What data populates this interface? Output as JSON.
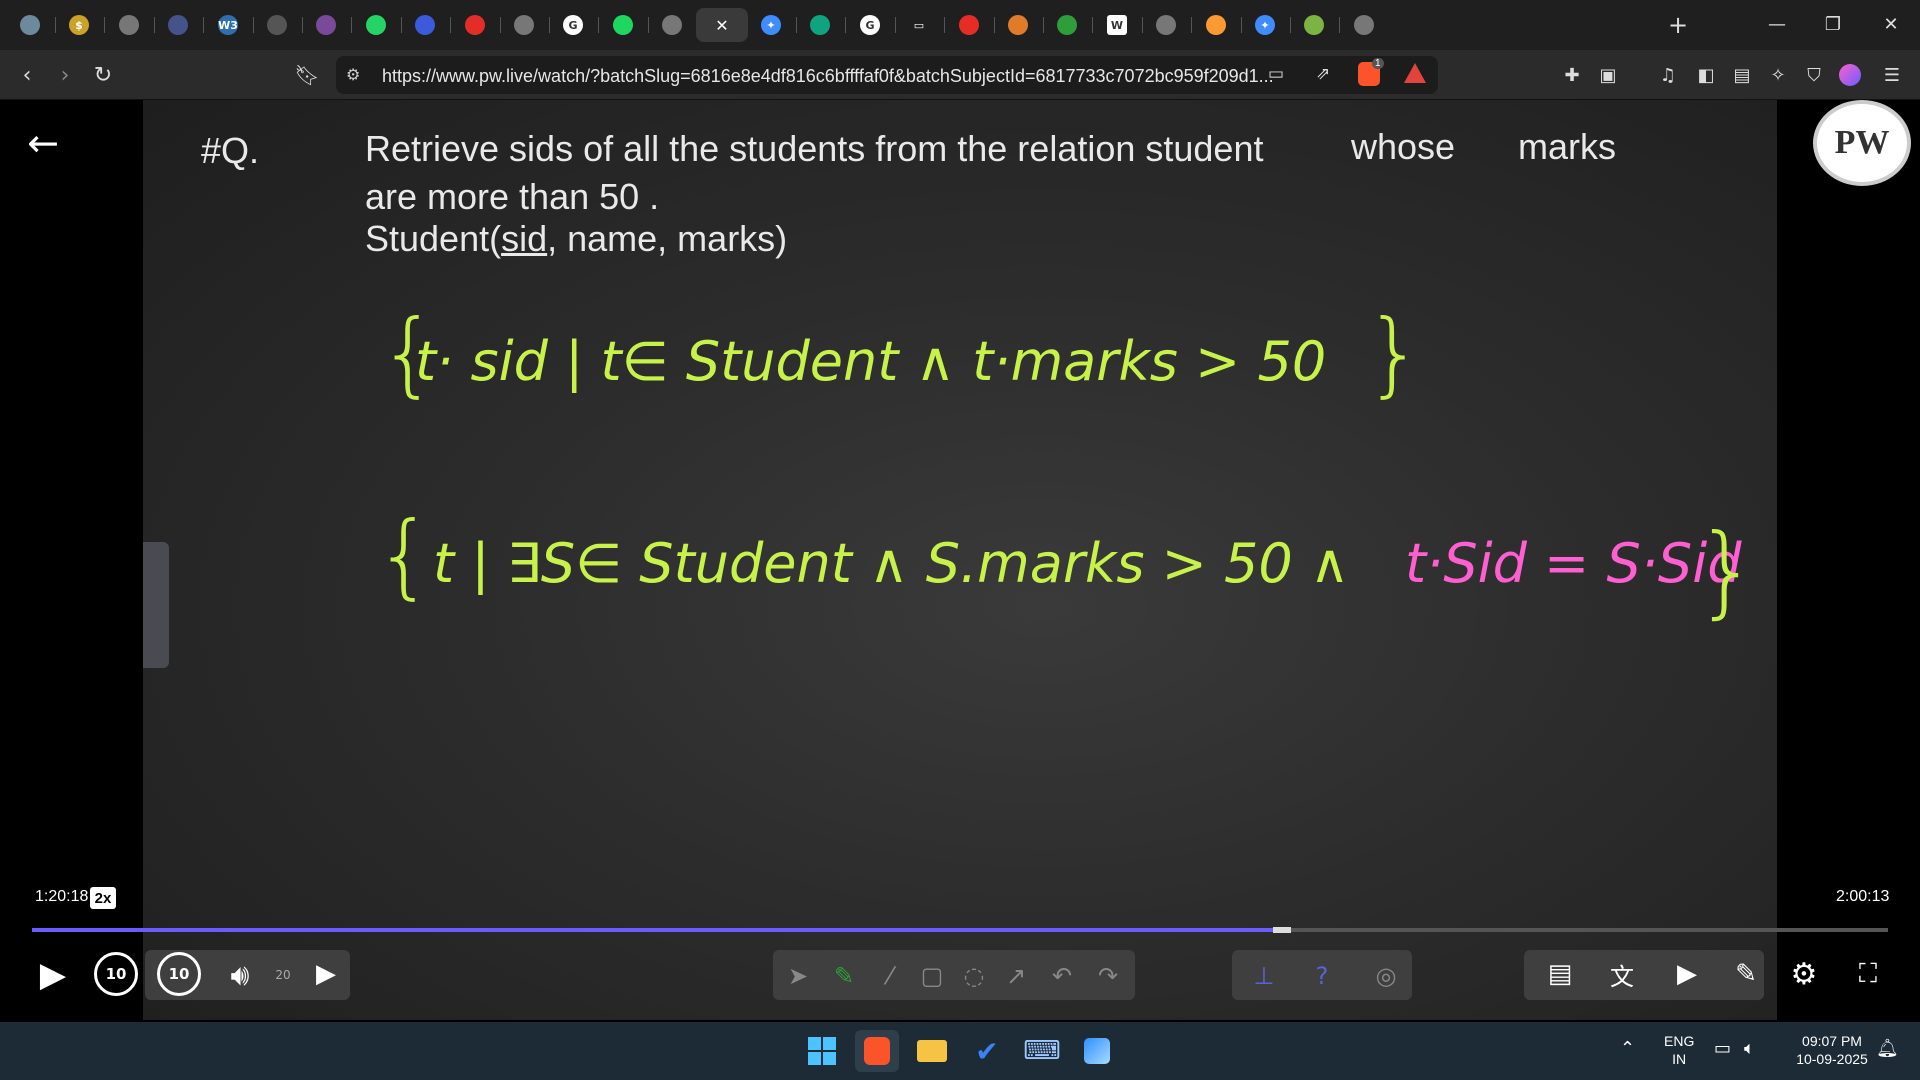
{
  "browser": {
    "tabs": [
      {
        "icon": "pw-icon",
        "color": "#6d8a9c",
        "glyph": ""
      },
      {
        "icon": "coin-icon",
        "color": "#c9a227",
        "glyph": "$"
      },
      {
        "icon": "globe-icon",
        "color": "#777777",
        "glyph": ""
      },
      {
        "icon": "site-icon",
        "color": "#44548a",
        "glyph": ""
      },
      {
        "icon": "w3schools-icon",
        "color": "#2f6fb0",
        "glyph": "W3"
      },
      {
        "icon": "site-icon",
        "color": "#555555",
        "glyph": ""
      },
      {
        "icon": "site-icon",
        "color": "#7a4a9a",
        "glyph": ""
      },
      {
        "icon": "whatsapp-icon",
        "color": "#25d366",
        "glyph": ""
      },
      {
        "icon": "bookmark-icon",
        "color": "#3b5bdb",
        "glyph": ""
      },
      {
        "icon": "youtube-icon",
        "color": "#e52d27",
        "glyph": ""
      },
      {
        "icon": "onlinegdb-icon",
        "color": "#777777",
        "glyph": ""
      },
      {
        "icon": "google-icon",
        "color": "#ffffff",
        "glyph": "G"
      },
      {
        "icon": "spotify-icon",
        "color": "#1ed760",
        "glyph": ""
      },
      {
        "icon": "globe-icon",
        "color": "#777777",
        "glyph": ""
      },
      {
        "icon": "close-icon",
        "color": "#3a3a3a",
        "glyph": "✕",
        "active": true
      },
      {
        "icon": "gemini-icon",
        "color": "#3f8cff",
        "glyph": "✦"
      },
      {
        "icon": "chatgpt-icon",
        "color": "#10a37f",
        "glyph": ""
      },
      {
        "icon": "google-icon",
        "color": "#ffffff",
        "glyph": "G"
      },
      {
        "icon": "screen-icon",
        "color": "#1f1f1f",
        "glyph": "▭"
      },
      {
        "icon": "youtube-icon",
        "color": "#e52d27",
        "glyph": ""
      },
      {
        "icon": "site-icon",
        "color": "#e07b2a",
        "glyph": ""
      },
      {
        "icon": "site-icon",
        "color": "#2e9d3a",
        "glyph": ""
      },
      {
        "icon": "wikipedia-icon",
        "color": "#ffffff",
        "glyph": "W"
      },
      {
        "icon": "globe-icon",
        "color": "#777777",
        "glyph": ""
      },
      {
        "icon": "india-flag-icon",
        "color": "#ff9933",
        "glyph": ""
      },
      {
        "icon": "gemini-icon",
        "color": "#3f8cff",
        "glyph": "✦"
      },
      {
        "icon": "site-icon",
        "color": "#7cb342",
        "glyph": ""
      },
      {
        "icon": "globe-icon",
        "color": "#777777",
        "glyph": ""
      }
    ],
    "new_tab_label": "+",
    "url": "https://www.pw.live/watch/?batchSlug=6816e8e4df816c6bffffaf0f&batchSubjectId=6817733c7072bc959f209d1...",
    "brave_badge": "1"
  },
  "lecture": {
    "q_label": "#Q.",
    "line1": "Retrieve sids of all the students  from the relation student",
    "line1_whose": "whose",
    "line1_marks": "marks",
    "line2": "are more than 50 .",
    "line3_pre": "Student(",
    "line3_key": "sid",
    "line3_post": ", name, marks)",
    "logo": "PW"
  },
  "handwriting": {
    "green_color": "#c6f24a",
    "pink_color": "#ff5fd0",
    "expr1_open": "{",
    "expr1_body": "t· sid | t∈ Student  ∧  t·marks > 50",
    "expr1_close": "}",
    "expr2_open": "{",
    "expr2_green": "t  | ∃S∈ Student  ∧  S.marks > 50  ∧ ",
    "expr2_pink": "t·Sid = S·Sid",
    "expr2_close": "}"
  },
  "player": {
    "elapsed": "1:20:18",
    "speed": "2x",
    "total": "2:00:13",
    "progress": 0.6686,
    "rewind_label": "10",
    "forward_label": "10",
    "volume_label": "20"
  },
  "taskbar": {
    "lang_top": "ENG",
    "lang_bottom": "IN",
    "time": "09:07 PM",
    "date": "10-09-2025"
  }
}
